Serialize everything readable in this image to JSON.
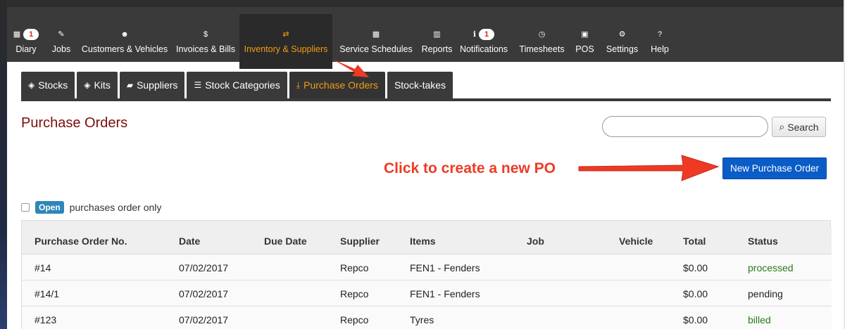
{
  "nav": [
    {
      "icon": "calendar-icon",
      "glyph": "▦",
      "badge": "1",
      "label": "Diary"
    },
    {
      "icon": "wrench-icon",
      "glyph": "✎",
      "label": "Jobs"
    },
    {
      "icon": "users-icon",
      "glyph": "☻",
      "label": "Customers & Vehicles"
    },
    {
      "icon": "dollar-icon",
      "glyph": "$",
      "label": "Invoices & Bills"
    },
    {
      "icon": "retweet-icon",
      "glyph": "⇄",
      "label": "Inventory & Suppliers",
      "active": true
    },
    {
      "icon": "calendar-icon",
      "glyph": "▦",
      "label": "Service Schedules"
    },
    {
      "icon": "bar-chart-icon",
      "glyph": "▥",
      "label": "Reports"
    },
    {
      "icon": "info-icon",
      "glyph": "ℹ",
      "badge": "1",
      "label": "Notifications"
    },
    {
      "icon": "clock-icon",
      "glyph": "◷",
      "label": "Timesheets"
    },
    {
      "icon": "money-icon",
      "glyph": "▣",
      "label": "POS"
    },
    {
      "icon": "cogs-icon",
      "glyph": "⚙",
      "label": "Settings"
    },
    {
      "icon": "question-icon",
      "glyph": "?",
      "label": "Help"
    }
  ],
  "tabs": [
    {
      "icon": "tags-icon",
      "glyph": "◈",
      "label": "Stocks"
    },
    {
      "icon": "tags-icon",
      "glyph": "◈",
      "label": "Kits"
    },
    {
      "icon": "truck-icon",
      "glyph": "▰",
      "label": "Suppliers"
    },
    {
      "icon": "list-icon",
      "glyph": "☰",
      "label": "Stock Categories"
    },
    {
      "icon": "download-icon",
      "glyph": "⤓",
      "label": "Purchase Orders",
      "active": true
    },
    {
      "icon": "",
      "glyph": "",
      "label": "Stock-takes"
    }
  ],
  "page_title": "Purchase Orders",
  "search": {
    "value": "",
    "button_label": "Search"
  },
  "new_po_button": "New Purchase Order",
  "annotation": "Click to create a new PO",
  "filter": {
    "badge": "Open",
    "label": "purchases order only",
    "checked": false
  },
  "table": {
    "headers": [
      "Purchase Order No.",
      "Date",
      "Due Date",
      "Supplier",
      "Items",
      "Job",
      "Vehicle",
      "Total",
      "Status"
    ],
    "rows": [
      [
        "#14",
        "07/02/2017",
        "",
        "Repco",
        "FEN1 - Fenders",
        "",
        "",
        "$0.00",
        "processed"
      ],
      [
        "#14/1",
        "07/02/2017",
        "",
        "Repco",
        "FEN1 - Fenders",
        "",
        "",
        "$0.00",
        "pending"
      ],
      [
        "#123",
        "07/02/2017",
        "",
        "Repco",
        "Tyres",
        "",
        "",
        "$0.00",
        "billed"
      ]
    ]
  },
  "colors": {
    "nav_bg": "#3a3a3a",
    "accent_orange": "#f39c12",
    "title_red": "#7a0d0d",
    "primary_blue": "#0a5cc7",
    "annotation_red": "#ee3a24",
    "status_green": "#2a7a1a"
  }
}
